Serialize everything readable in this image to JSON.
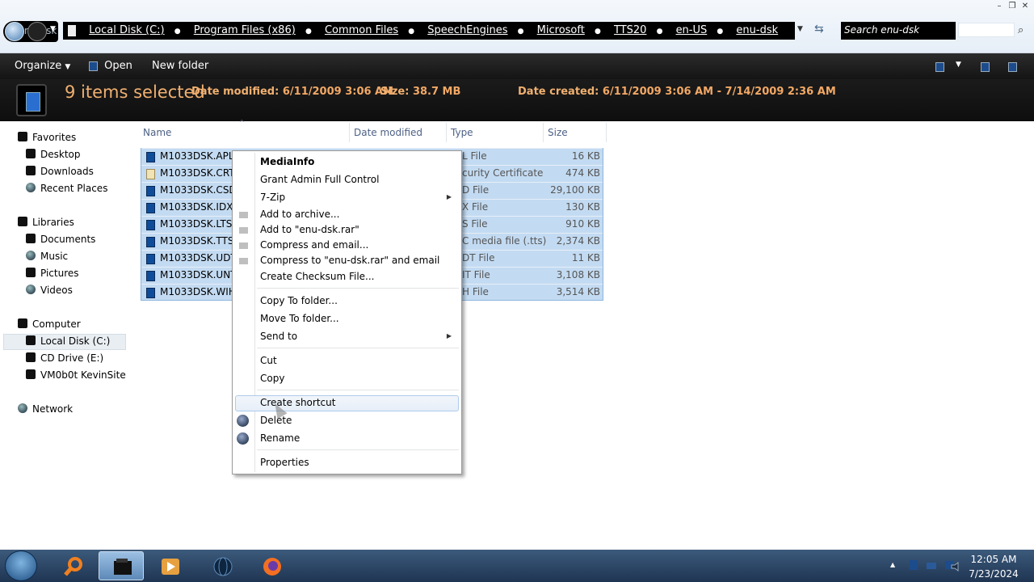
{
  "window": {
    "back_label": "nu-dsk",
    "breadcrumbs": [
      "Local Disk (C:)",
      "Program Files (x86)",
      "Common Files",
      "SpeechEngines",
      "Microsoft",
      "TTS20",
      "en-US",
      "enu-dsk"
    ],
    "search_placeholder": "Search enu-dsk",
    "minimize": "–",
    "maximize": "❐",
    "close": "✕"
  },
  "toolbar": {
    "organize": "Organize",
    "open": "Open",
    "new_folder": "New folder"
  },
  "details": {
    "selection": "9 items selected",
    "date_modified_label": "Date modified:",
    "date_modified": "6/11/2009 3:06 AM",
    "size_label": "Size:",
    "size": "38.7 MB",
    "date_created_label": "Date created:",
    "date_created": "6/11/2009 3:06 AM - 7/14/2009 2:36 AM"
  },
  "nav": {
    "favorites": "Favorites",
    "desktop": "Desktop",
    "downloads": "Downloads",
    "recent_places": "Recent Places",
    "libraries": "Libraries",
    "documents": "Documents",
    "music": "Music",
    "pictures": "Pictures",
    "videos": "Videos",
    "computer": "Computer",
    "local_disk": "Local Disk (C:)",
    "cd_drive": "CD Drive (E:)",
    "network_drive": "VM0b0t KevinSite",
    "network": "Network"
  },
  "columns": {
    "name": "Name",
    "date_modified": "Date modified",
    "type": "Type",
    "size": "Size"
  },
  "files": [
    {
      "name": "M1033DSK.APL",
      "type": "L File",
      "size": "16 KB"
    },
    {
      "name": "M1033DSK.CRT",
      "type": "curity Certificate",
      "size": "474 KB"
    },
    {
      "name": "M1033DSK.CSD",
      "type": "D File",
      "size": "29,100 KB"
    },
    {
      "name": "M1033DSK.IDX",
      "type": "X File",
      "size": "130 KB"
    },
    {
      "name": "M1033DSK.LTS",
      "type": "S File",
      "size": "910 KB"
    },
    {
      "name": "M1033DSK.TTS",
      "type": "C media file (.tts)",
      "size": "2,374 KB"
    },
    {
      "name": "M1033DSK.UDT",
      "type": "DT File",
      "size": "11 KB"
    },
    {
      "name": "M1033DSK.UNT",
      "type": "IT File",
      "size": "3,108 KB"
    },
    {
      "name": "M1033DSK.WIH",
      "type": "H File",
      "size": "3,514 KB"
    }
  ],
  "context_menu": {
    "mediainfo": "MediaInfo",
    "grant_admin": "Grant Admin Full Control",
    "seven_zip": "7-Zip",
    "add_archive": "Add to archive...",
    "add_rar": "Add to \"enu-dsk.rar\"",
    "compress_email": "Compress and email...",
    "compress_rar_email": "Compress to \"enu-dsk.rar\" and email",
    "checksum": "Create Checksum File...",
    "copy_to": "Copy To folder...",
    "move_to": "Move To folder...",
    "send_to": "Send to",
    "cut": "Cut",
    "copy": "Copy",
    "create_shortcut": "Create shortcut",
    "delete": "Delete",
    "rename": "Rename",
    "properties": "Properties"
  },
  "taskbar": {
    "time": "12:05 AM",
    "date": "7/23/2024"
  },
  "colors": {
    "selection_bg": "#c3dbf2",
    "details_text": "#f0b070",
    "header_bg": "#1a1a1a"
  }
}
